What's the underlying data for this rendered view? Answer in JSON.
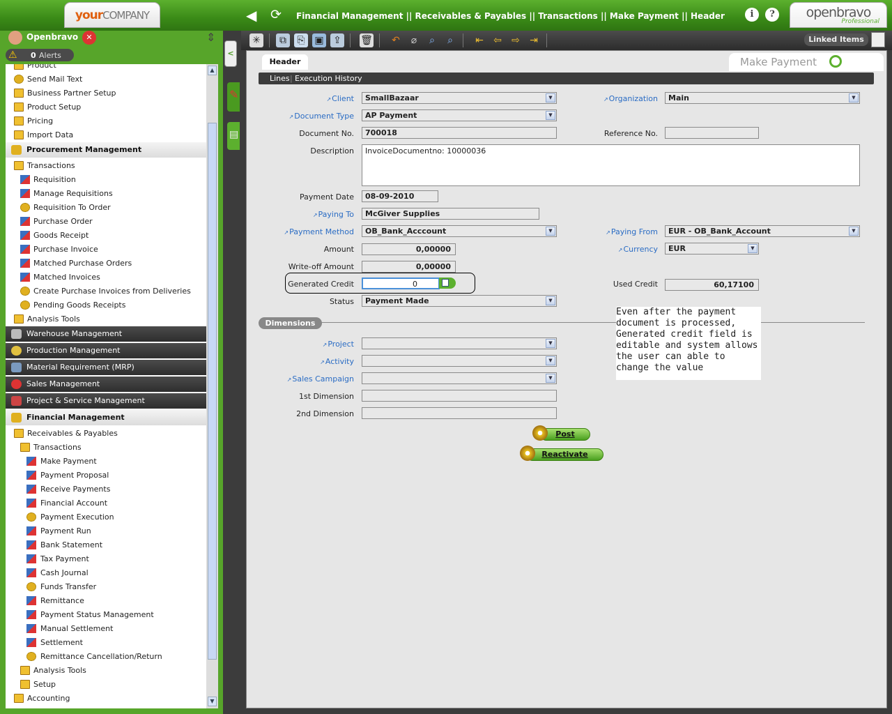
{
  "brand": {
    "your": "your",
    "company": "COMPANY",
    "ob_name": "openbravo",
    "ob_sub": "Professional"
  },
  "breadcrumb": "Financial Management || Receivables & Payables || Transactions || Make Payment  ||  Header",
  "user": {
    "name": "Openbravo",
    "alerts_count": "0",
    "alerts_label": "Alerts"
  },
  "linked_items": "Linked Items",
  "menu": {
    "top_items": [
      {
        "label": "Product",
        "icon": "folder"
      },
      {
        "label": "Send Mail Text",
        "icon": "gear"
      },
      {
        "label": "Business Partner Setup",
        "icon": "folder"
      },
      {
        "label": "Product Setup",
        "icon": "folder"
      },
      {
        "label": "Pricing",
        "icon": "folder"
      },
      {
        "label": "Import Data",
        "icon": "folder"
      }
    ],
    "procurement": {
      "title": "Procurement Management",
      "transactions": "Transactions",
      "items": [
        "Requisition",
        "Manage Requisitions",
        "Requisition To Order",
        "Purchase Order",
        "Goods Receipt",
        "Purchase Invoice",
        "Matched Purchase Orders",
        "Matched Invoices",
        "Create Purchase Invoices from Deliveries",
        "Pending Goods Receipts"
      ],
      "analysis": "Analysis Tools"
    },
    "sections": [
      "Warehouse Management",
      "Production Management",
      "Material Requirement (MRP)",
      "Sales Management",
      "Project & Service Management"
    ],
    "financial": {
      "title": "Financial Management",
      "rp": "Receivables & Payables",
      "transactions": "Transactions",
      "items": [
        "Make Payment",
        "Payment Proposal",
        "Receive Payments",
        "Financial Account",
        "Payment Execution",
        "Payment Run",
        "Bank Statement",
        "Tax Payment",
        "Cash Journal",
        "Funds Transfer",
        "Remittance",
        "Payment Status Management",
        "Manual Settlement",
        "Settlement",
        "Remittance Cancellation/Return"
      ],
      "analysis": "Analysis Tools",
      "setup": "Setup",
      "accounting": "Accounting"
    }
  },
  "page": {
    "title": "Make Payment",
    "tab": "Header",
    "subtabs": [
      "Lines",
      "Execution History"
    ]
  },
  "form": {
    "client": {
      "label": "Client",
      "value": "SmallBazaar"
    },
    "organization": {
      "label": "Organization",
      "value": "Main"
    },
    "document_type": {
      "label": "Document Type",
      "value": "AP Payment"
    },
    "document_no": {
      "label": "Document No.",
      "value": "700018"
    },
    "reference_no": {
      "label": "Reference No.",
      "value": ""
    },
    "description": {
      "label": "Description",
      "value": "InvoiceDocumentno: 10000036"
    },
    "payment_date": {
      "label": "Payment Date",
      "value": "08-09-2010"
    },
    "paying_to": {
      "label": "Paying To",
      "value": "McGiver Supplies"
    },
    "payment_method": {
      "label": "Payment Method",
      "value": "OB_Bank_Acccount"
    },
    "paying_from": {
      "label": "Paying From",
      "value": "EUR - OB_Bank_Account"
    },
    "amount": {
      "label": "Amount",
      "value": "0,00000"
    },
    "currency": {
      "label": "Currency",
      "value": "EUR"
    },
    "writeoff": {
      "label": "Write-off Amount",
      "value": "0,00000"
    },
    "generated_credit": {
      "label": "Generated Credit",
      "value": "0"
    },
    "used_credit": {
      "label": "Used Credit",
      "value": "60,17100"
    },
    "status": {
      "label": "Status",
      "value": "Payment Made"
    }
  },
  "dimensions": {
    "label": "Dimensions",
    "project": "Project",
    "activity": "Activity",
    "sales_campaign": "Sales Campaign",
    "dim1": "1st Dimension",
    "dim2": "2nd Dimension"
  },
  "buttons": {
    "post": "Post",
    "reactivate": "Reactivate"
  },
  "note": "Even after the payment document is processed, Generated credit field is editable and system allows the user can able to change the value"
}
